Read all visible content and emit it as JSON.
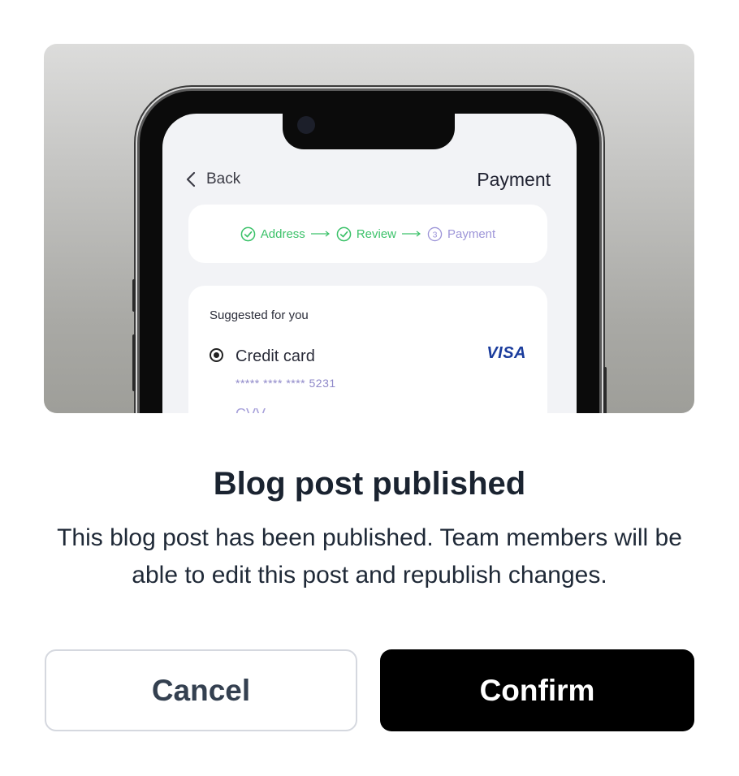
{
  "preview": {
    "back_label": "Back",
    "screen_title": "Payment",
    "steps": [
      {
        "label": "Address",
        "marker": "check",
        "state": "done"
      },
      {
        "label": "Review",
        "marker": "check",
        "state": "done"
      },
      {
        "label": "Payment",
        "marker": "3",
        "state": "current"
      }
    ],
    "suggested_label": "Suggested for you",
    "method_label": "Credit card",
    "card_brand": "VISA",
    "card_number": "***** **** **** 5231",
    "cvv_label": "CVV",
    "colors": {
      "done": "#3cc26a",
      "current": "#9d95d8",
      "brand": "#1a3c9c"
    }
  },
  "dialog": {
    "title": "Blog post published",
    "description": "This blog post has been published. Team members will be able to edit this post and republish changes.",
    "cancel_label": "Cancel",
    "confirm_label": "Confirm"
  }
}
